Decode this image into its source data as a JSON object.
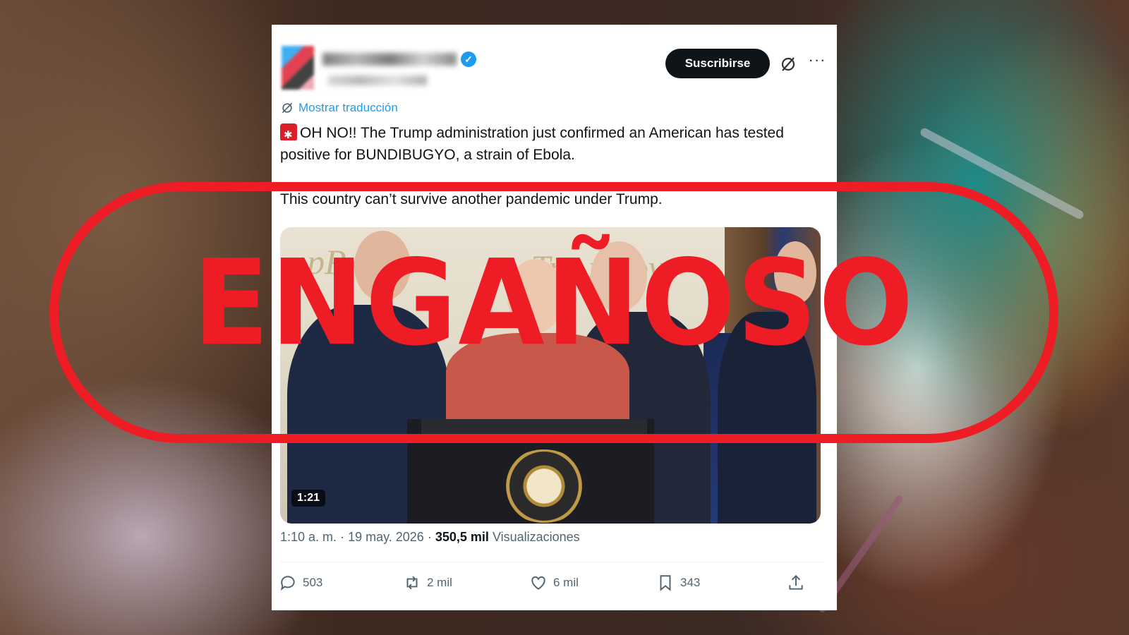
{
  "header": {
    "subscribe_label": "Suscribirse",
    "more_label": "···"
  },
  "translation_link": "Mostrar traducción",
  "tweet": {
    "line1": "OH NO!! The Trump administration just confirmed an American has tested positive for BUNDIBUGYO, a strain of Ebola.",
    "line2": "This country can’t survive another pandemic under Trump."
  },
  "video": {
    "duration": "1:21",
    "background_text_left": "mpRx",
    "background_text_right": "Tru   x.gov"
  },
  "meta": {
    "time": "1:10 a. m.",
    "separator": "·",
    "date": "19 may. 2026",
    "views_count": "350,5 mil",
    "views_label": "Visualizaciones"
  },
  "actions": {
    "replies": "503",
    "reposts": "2 mil",
    "likes": "6 mil",
    "bookmarks": "343"
  },
  "verdict": {
    "label": "ENGAÑOSO",
    "color": "#ee1c24"
  },
  "colors": {
    "accent": "#1d9bf0",
    "text": "#0f1419",
    "muted": "#536471"
  }
}
